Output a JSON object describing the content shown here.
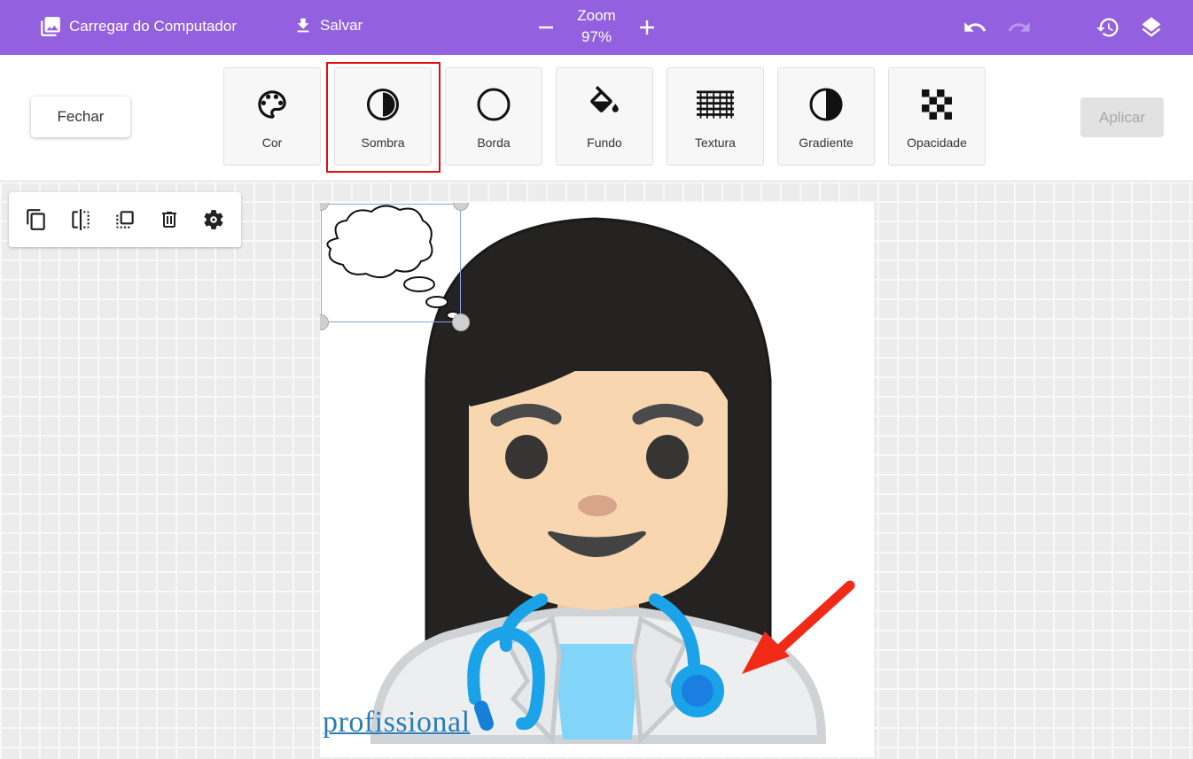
{
  "topbar": {
    "upload_label": "Carregar do Computador",
    "save_label": "Salvar",
    "zoom_label": "Zoom",
    "zoom_value": "97%"
  },
  "toolbar": {
    "close_label": "Fechar",
    "apply_label": "Aplicar",
    "tools": [
      "Cor",
      "Sombra",
      "Borda",
      "Fundo",
      "Textura",
      "Gradiente",
      "Opacidade"
    ],
    "selected_tool": "Sombra"
  },
  "canvas": {
    "caption": "profissional"
  },
  "colors": {
    "topbar": "#9360e0",
    "highlight": "#e01010",
    "arrow": "#f02a17",
    "stethoscope": "#1aa3e8"
  }
}
